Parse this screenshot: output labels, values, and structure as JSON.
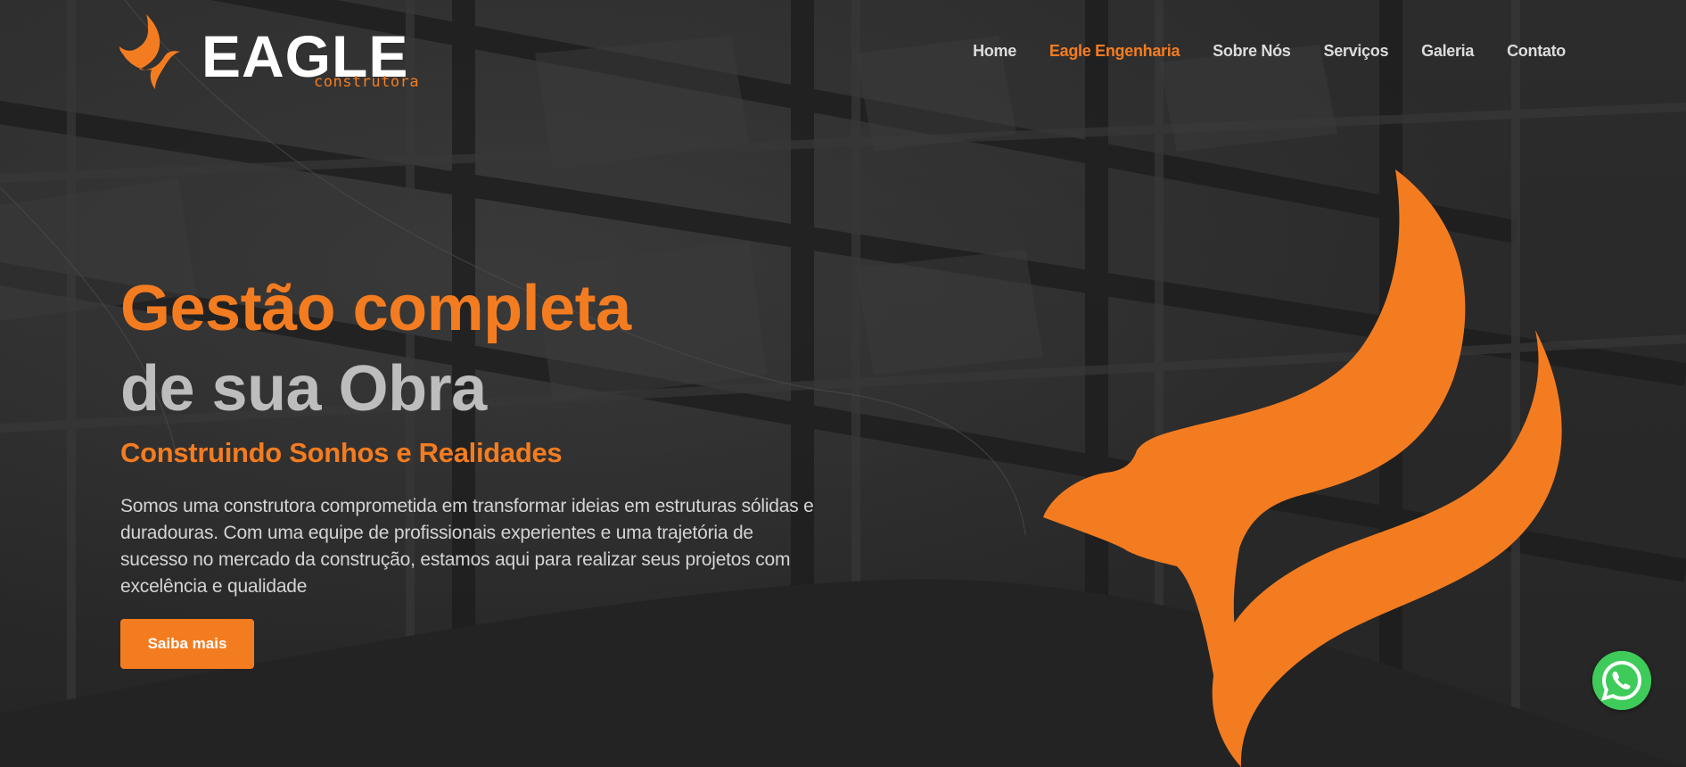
{
  "brand": {
    "name": "EAGLE",
    "tagline": "construtora",
    "accent_color": "#f47c20",
    "logo_icon": "eagle-flame-icon"
  },
  "nav": {
    "items": [
      {
        "label": "Home",
        "active": false
      },
      {
        "label": "Eagle Engenharia",
        "active": true
      },
      {
        "label": "Sobre Nós",
        "active": false
      },
      {
        "label": "Serviços",
        "active": false
      },
      {
        "label": "Galeria",
        "active": false
      },
      {
        "label": "Contato",
        "active": false
      }
    ]
  },
  "hero": {
    "title_line1": "Gestão completa",
    "title_line2": "de sua Obra",
    "subtitle": "Construindo Sonhos e Realidades",
    "description": "Somos uma construtora comprometida em transformar ideias em estruturas sólidas e duradouras. Com uma equipe de profissionais experientes e uma trajetória de sucesso no mercado da construção, estamos aqui para realizar seus projetos com excelência e qualidade",
    "cta_label": "Saiba mais",
    "illustration": "eagle-flame-icon"
  },
  "floating": {
    "icon": "whatsapp-icon",
    "color": "#3ecb5a"
  }
}
